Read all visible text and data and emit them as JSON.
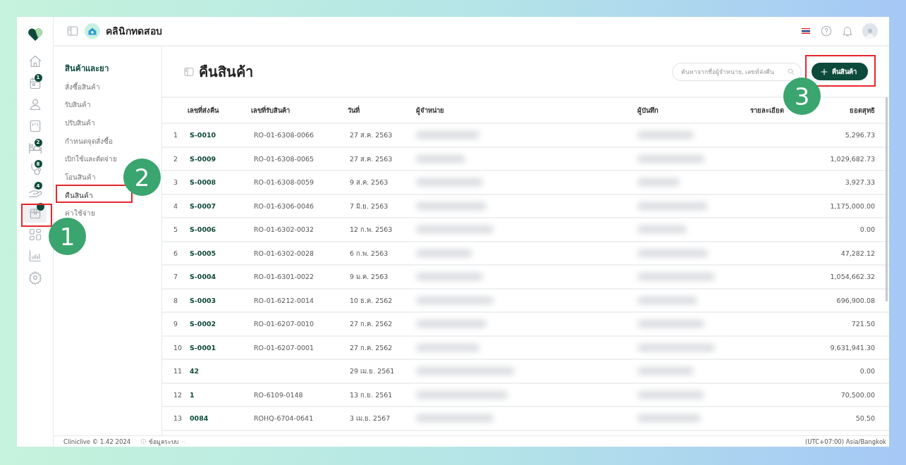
{
  "topbar": {
    "clinic_name": "คลินิกทดสอบ"
  },
  "rail": [
    {
      "kind": "home",
      "selected": false
    },
    {
      "kind": "calendar",
      "badge": "1",
      "selected": false
    },
    {
      "kind": "person",
      "selected": false
    },
    {
      "kind": "card",
      "selected": false
    },
    {
      "kind": "bed",
      "badge": "2",
      "selected": false
    },
    {
      "kind": "stethoscope",
      "badge": "8",
      "selected": false
    },
    {
      "kind": "hand",
      "badge": "4",
      "selected": false
    },
    {
      "kind": "box",
      "selected": true,
      "dot": true
    },
    {
      "kind": "grid",
      "selected": false
    },
    {
      "kind": "chart",
      "selected": false
    },
    {
      "kind": "gear",
      "selected": false
    }
  ],
  "submenu": {
    "title": "สินค้าและยา",
    "items": [
      {
        "label": "สั่งซื้อสินค้า",
        "selected": false
      },
      {
        "label": "รับสินค้า",
        "selected": false
      },
      {
        "label": "ปรับสินค้า",
        "selected": false
      },
      {
        "label": "กำหนดจุดสั่งซื้อ",
        "selected": false
      },
      {
        "label": "เบิกใช้และตัดจ่าย",
        "selected": false
      },
      {
        "label": "โอนสินค้า",
        "selected": false
      },
      {
        "label": "คืนสินค้า",
        "selected": true
      },
      {
        "label": "ค่าใช้จ่าย",
        "selected": false
      }
    ]
  },
  "page": {
    "title": "คืนสินค้า",
    "search": {
      "placeholder": "ค้นหาจากชื่อผู้จำหน่าย, เลขที่ส่งคืน"
    },
    "add_button": "คืนสินค้า"
  },
  "table": {
    "columns": [
      "เลขที่ส่งคืน",
      "เลขที่รับสินค้า",
      "วันที่",
      "ผู้จำหน่าย",
      "ผู้บันทึก",
      "รายละเอียด",
      "ยอดสุทธิ"
    ],
    "rows": [
      {
        "index": "1",
        "return_no": "S-0010",
        "receipt_no": "RO-01-6308-0066",
        "date": "27 ส.ค. 2563",
        "net": "5,296.73"
      },
      {
        "index": "2",
        "return_no": "S-0009",
        "receipt_no": "RO-01-6308-0065",
        "date": "27 ส.ค. 2563",
        "net": "1,029,682.73"
      },
      {
        "index": "3",
        "return_no": "S-0008",
        "receipt_no": "RO-01-6308-0059",
        "date": "9 ส.ค. 2563",
        "net": "3,927.33"
      },
      {
        "index": "4",
        "return_no": "S-0007",
        "receipt_no": "RO-01-6306-0046",
        "date": "7 มิ.ย. 2563",
        "net": "1,175,000.00"
      },
      {
        "index": "5",
        "return_no": "S-0006",
        "receipt_no": "RO-01-6302-0032",
        "date": "12 ก.พ. 2563",
        "net": "0.00"
      },
      {
        "index": "6",
        "return_no": "S-0005",
        "receipt_no": "RO-01-6302-0028",
        "date": "6 ก.พ. 2563",
        "net": "47,282.12"
      },
      {
        "index": "7",
        "return_no": "S-0004",
        "receipt_no": "RO-01-6301-0022",
        "date": "9 ม.ค. 2563",
        "net": "1,054,662.32"
      },
      {
        "index": "8",
        "return_no": "S-0003",
        "receipt_no": "RO-01-6212-0014",
        "date": "10 ธ.ค. 2562",
        "net": "696,900.08"
      },
      {
        "index": "9",
        "return_no": "S-0002",
        "receipt_no": "RO-01-6207-0010",
        "date": "27 ก.ค. 2562",
        "net": "721.50"
      },
      {
        "index": "10",
        "return_no": "S-0001",
        "receipt_no": "RO-01-6207-0001",
        "date": "27 ก.ค. 2562",
        "net": "9,631,941.30"
      },
      {
        "index": "11",
        "return_no": "42",
        "date": "29 เม.ย. 2561",
        "net": "0.00"
      },
      {
        "index": "12",
        "return_no": "1",
        "receipt_no": "RO-6109-0148",
        "date": "13 ก.ย. 2561",
        "net": "70,500.00"
      },
      {
        "index": "13",
        "return_no": "0084",
        "receipt_no": "ROHQ-6704-0641",
        "date": "3 เม.ย. 2567",
        "net": "50.50"
      }
    ]
  },
  "footer": {
    "version": "Cliniclive © 1.42 2024",
    "system_info": "ข้อมูลระบบ",
    "timezone": "(UTC+07:00) Asia/Bangkok"
  },
  "annotations": [
    {
      "label": "1"
    },
    {
      "label": "2"
    },
    {
      "label": "3"
    }
  ]
}
